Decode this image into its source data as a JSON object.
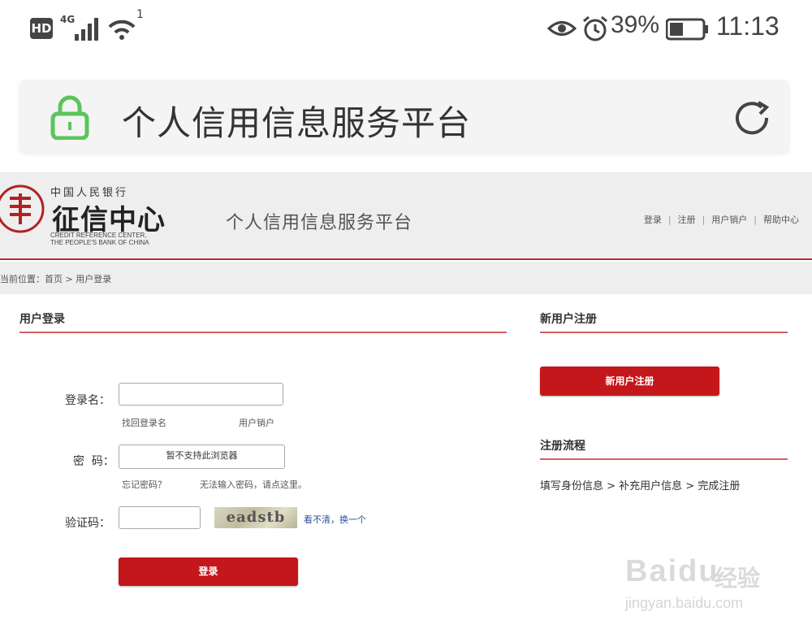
{
  "status_bar": {
    "hd": "HD",
    "network": "4G",
    "wifi_sup": "1",
    "battery": "39%",
    "time": "11:13",
    "icons": [
      "eye-icon",
      "alarm-icon",
      "battery-icon",
      "signal-icon",
      "wifi-icon"
    ]
  },
  "address_bar": {
    "title": "个人信用信息服务平台",
    "icons": [
      "lock-icon",
      "refresh-icon"
    ],
    "lock_color": "#5cc45c"
  },
  "header": {
    "logo_top": "中国人民银行",
    "logo_main": "征信中心",
    "logo_en_1": "CREDIT REFERENCE CENTER,",
    "logo_en_2": "THE PEOPLE'S BANK OF CHINA",
    "platform": "个人信用信息服务平台",
    "links": [
      "登录",
      "注册",
      "用户销户",
      "帮助中心"
    ],
    "accent_color": "#c0282a"
  },
  "breadcrumb": "当前位置：首页 > 用户登录",
  "login": {
    "title": "用户登录",
    "username_label": "登录名：",
    "username_value": "",
    "find_username": "找回登录名",
    "cancel_account": "用户销户",
    "password_label": "密  码：",
    "password_notice": "暂不支持此浏览器",
    "forgot_password": "忘记密码？",
    "cannot_input": "无法输入密码，请点这里。",
    "captcha_label": "验证码：",
    "captcha_value": "",
    "captcha_text": "eadstb",
    "captcha_refresh": "看不清，换一个",
    "submit": "登录"
  },
  "register": {
    "title": "新用户注册",
    "button": "新用户注册",
    "flow_title": "注册流程",
    "flow_steps": "填写身份信息 > 补充用户信息 > 完成注册"
  },
  "watermark": {
    "brand": "Baidu",
    "brand_cn": "经验",
    "url": "jingyan.baidu.com"
  }
}
